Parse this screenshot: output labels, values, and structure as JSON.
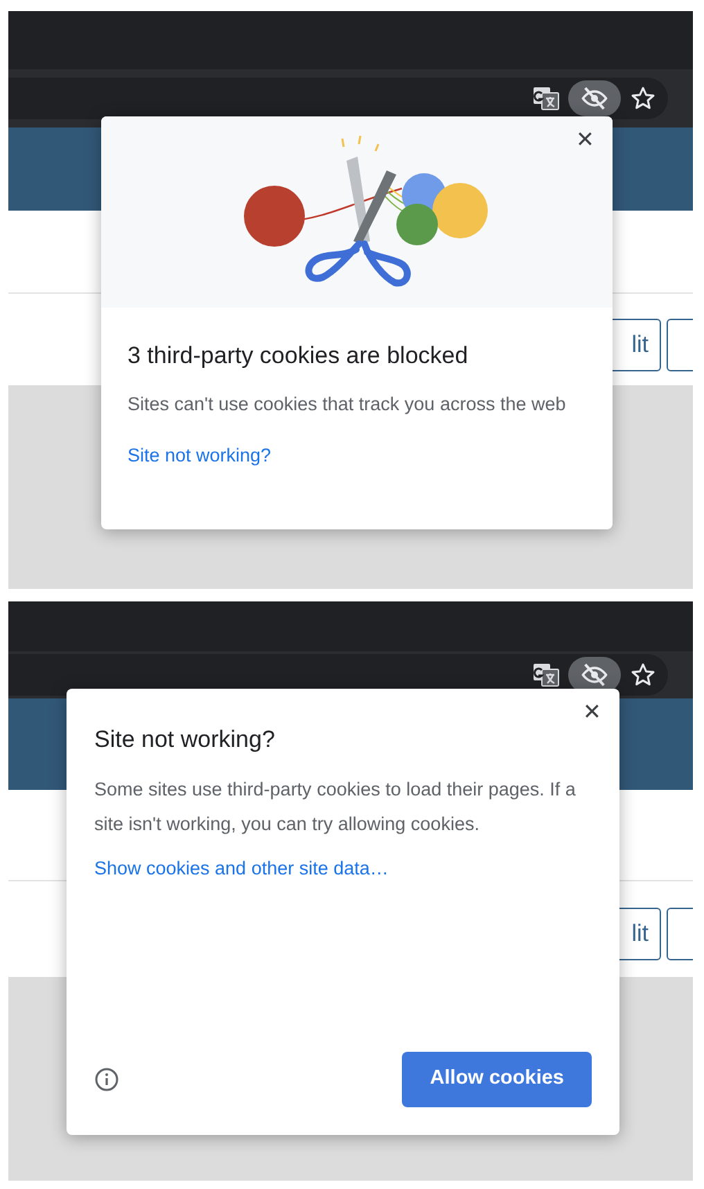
{
  "panels": [
    {
      "kind": "blocked",
      "page_button": "lit",
      "popup": {
        "title": "3 third-party cookies are blocked",
        "body": "Sites can't use cookies that track you across the web",
        "link": "Site not working?",
        "close": "✕"
      }
    },
    {
      "kind": "site_not_working",
      "page_button": "lit",
      "popup": {
        "title": "Site not working?",
        "body": "Some sites use third-party cookies to load their pages. If a site isn't working, you can try allowing cookies.",
        "link": "Show cookies and other site data…",
        "button": "Allow cookies",
        "close": "✕"
      }
    }
  ]
}
